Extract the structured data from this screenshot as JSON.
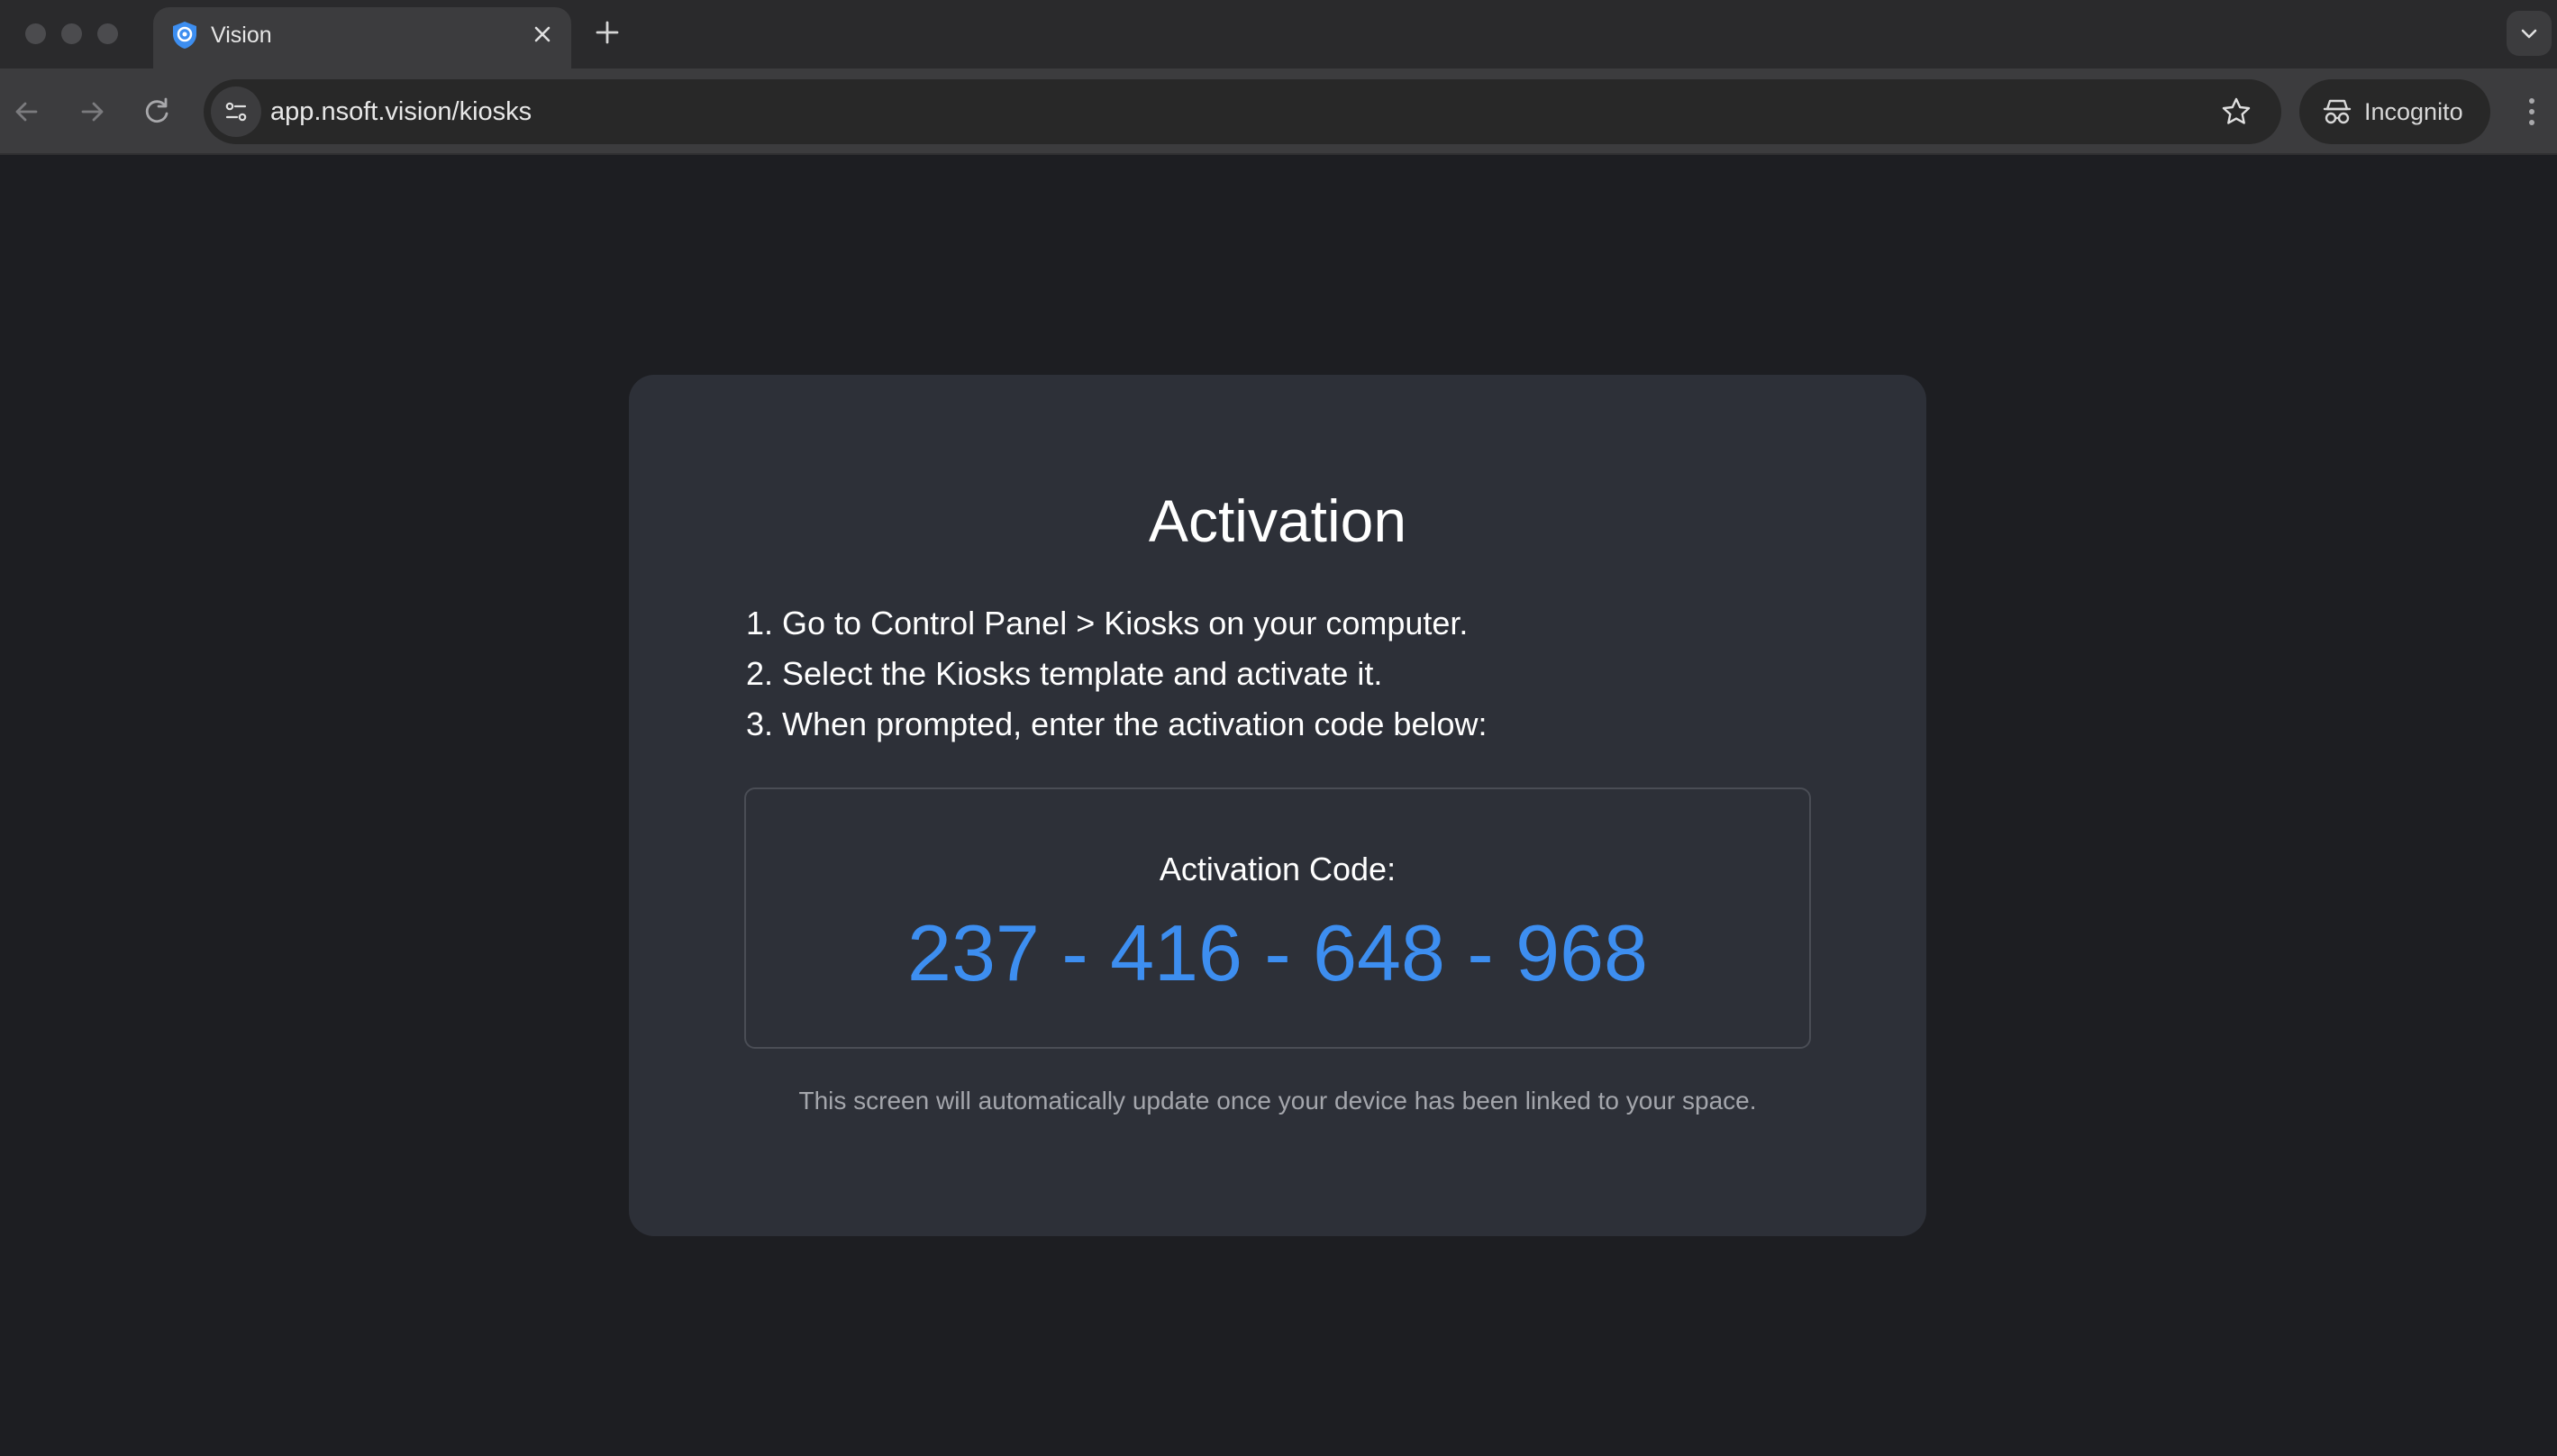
{
  "browser": {
    "tab": {
      "title": "Vision"
    },
    "address_bar": {
      "url": "app.nsoft.vision/kiosks"
    },
    "incognito_label": "Incognito"
  },
  "page": {
    "title": "Activation",
    "steps": [
      "1. Go to Control Panel > Kiosks on your computer.",
      "2. Select the Kiosks template and activate it.",
      "3. When prompted, enter the activation code below:"
    ],
    "code_label": "Activation Code:",
    "code_value": "237 - 416 - 648 - 968",
    "footnote": "This screen will automatically update once your device has been linked to your space."
  },
  "colors": {
    "background": "#1d1e22",
    "card": "#2d3038",
    "accent": "#3d8ef0"
  },
  "icons": {
    "favicon": "shield-icon",
    "close": "close-icon",
    "new_tab": "plus-icon",
    "tab_search": "chevron-down-icon",
    "back": "arrow-left-icon",
    "forward": "arrow-right-icon",
    "reload": "reload-icon",
    "site_info": "tune-icon",
    "bookmark": "star-icon",
    "incognito": "incognito-icon",
    "menu": "kebab-menu-icon"
  }
}
